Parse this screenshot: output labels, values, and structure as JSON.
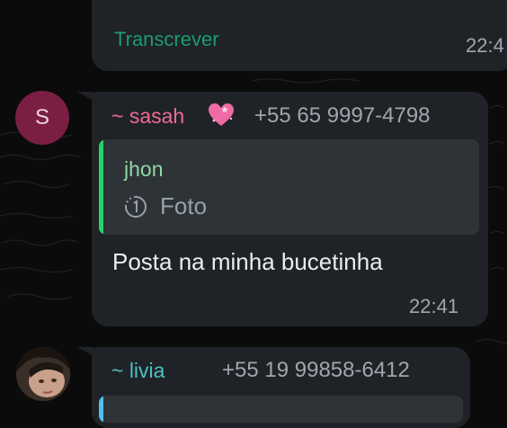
{
  "chat": {
    "top_message": {
      "transcribe_label": "Transcrever",
      "time": "22:4"
    },
    "main_message": {
      "avatar_letter": "S",
      "sender_name": "~ sasah",
      "sender_phone": "+55 65 9997-4798",
      "quoted": {
        "author": "jhon",
        "text": "Foto",
        "icon": "view-once-icon"
      },
      "text": "Posta na minha bucetinha",
      "time": "22:41"
    },
    "next_message": {
      "sender_name": "~ livia",
      "sender_phone": "+55 19 99858-6412"
    }
  },
  "colors": {
    "bubble": "#1f2327",
    "sender_sasah": "#f06a94",
    "sender_livia": "#4cc2c4",
    "quote_bar": "#25d366",
    "transcribe": "#1b9d6b"
  }
}
